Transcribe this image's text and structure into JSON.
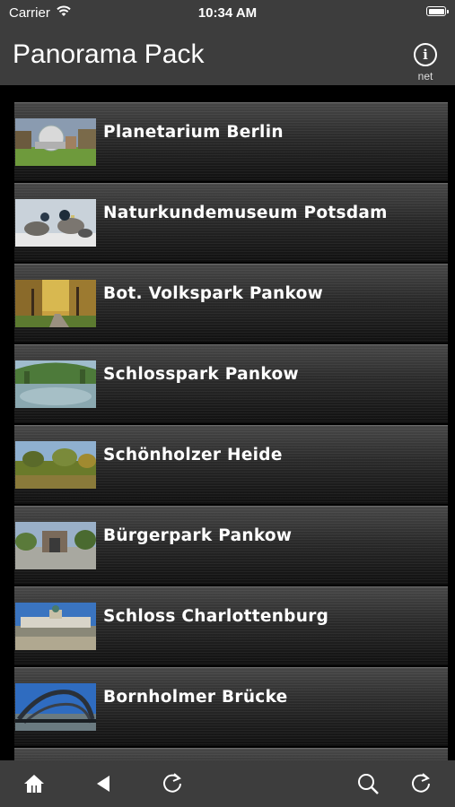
{
  "status_bar": {
    "carrier": "Carrier",
    "time": "10:34 AM"
  },
  "nav": {
    "title": "Panorama Pack",
    "info_label": "net",
    "info_icon": "info-icon"
  },
  "panoramas": [
    {
      "label": "Planetarium Berlin",
      "thumb_icon": "planetarium-thumbnail"
    },
    {
      "label": "Naturkundemuseum Potsdam",
      "thumb_icon": "ducks-thumbnail"
    },
    {
      "label": "Bot. Volkspark Pankow",
      "thumb_icon": "autumn-park-thumbnail"
    },
    {
      "label": "Schlosspark Pankow",
      "thumb_icon": "panorama-park-thumbnail"
    },
    {
      "label": "Schönholzer Heide",
      "thumb_icon": "heath-thumbnail"
    },
    {
      "label": "Bürgerpark Pankow",
      "thumb_icon": "gate-thumbnail"
    },
    {
      "label": "Schloss Charlottenburg",
      "thumb_icon": "palace-thumbnail"
    },
    {
      "label": "Bornholmer Brücke",
      "thumb_icon": "bridge-thumbnail"
    }
  ],
  "toolbar": {
    "items": [
      "home-icon",
      "back-icon",
      "reload-icon",
      "search-icon",
      "refresh-icon"
    ]
  },
  "colors": {
    "bar_background": "#3d3d3d",
    "list_background": "#000000",
    "text": "#ffffff"
  }
}
